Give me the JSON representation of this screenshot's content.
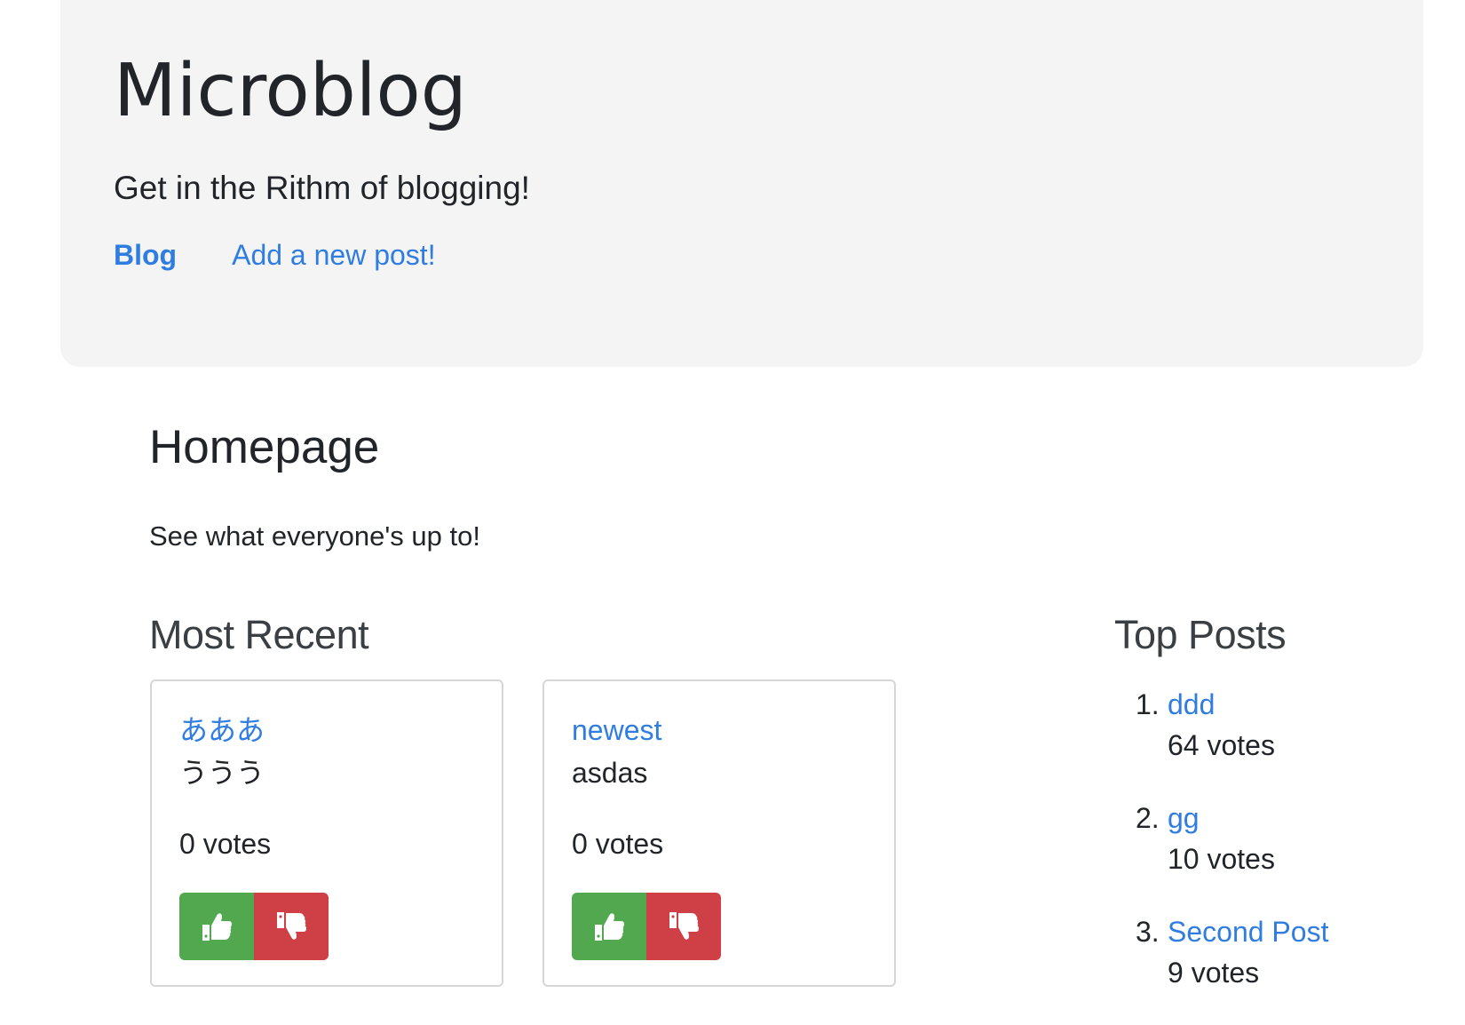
{
  "header": {
    "title": "Microblog",
    "tagline": "Get in the Rithm of blogging!",
    "nav": [
      {
        "label": "Blog",
        "active": true
      },
      {
        "label": "Add a new post!",
        "active": false
      }
    ]
  },
  "main": {
    "heading": "Homepage",
    "intro": "See what everyone's up to!",
    "recent_heading": "Most Recent",
    "top_heading": "Top Posts"
  },
  "recent_posts": [
    {
      "title": "あああ",
      "body": "ううう",
      "votes": "0 votes"
    },
    {
      "title": "newest",
      "body": "asdas",
      "votes": "0 votes"
    }
  ],
  "top_posts": [
    {
      "rank": "1.",
      "title": "ddd",
      "votes": "64 votes"
    },
    {
      "rank": "2.",
      "title": "gg",
      "votes": "10 votes"
    },
    {
      "rank": "3.",
      "title": "Second Post",
      "votes": "9 votes"
    }
  ],
  "icons": {
    "upvote": "thumbs-up-icon",
    "downvote": "thumbs-down-icon"
  },
  "colors": {
    "link": "#2f7de1",
    "upvote": "#51a84f",
    "downvote": "#cf3f46",
    "jumbotron": "#f4f4f4"
  }
}
